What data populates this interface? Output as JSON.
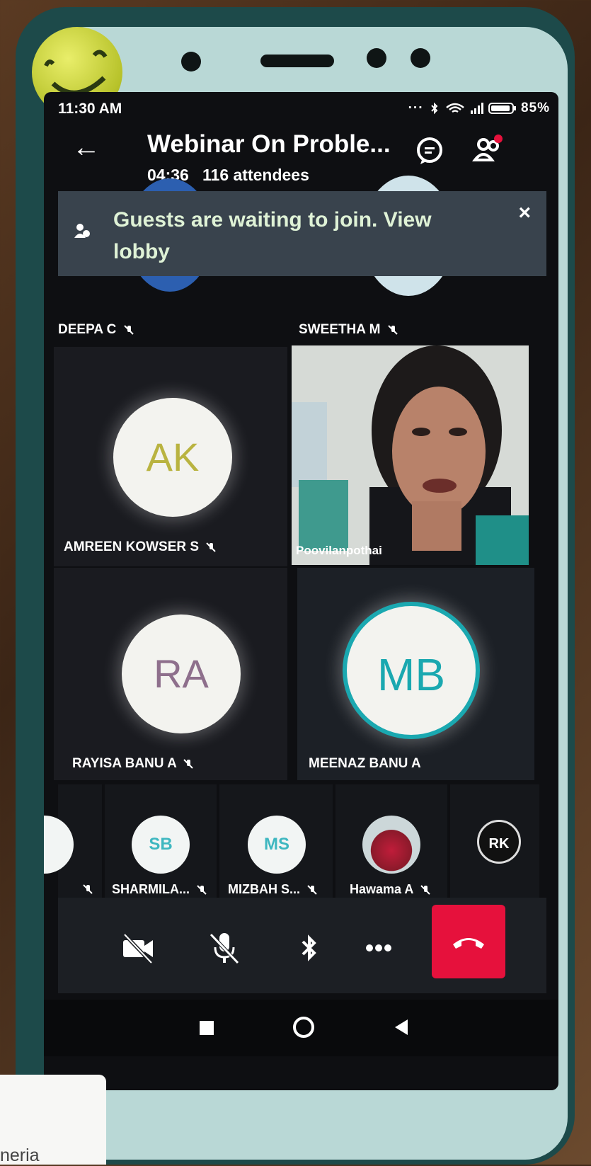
{
  "status_bar": {
    "time": "11:30 AM",
    "indicators": "... ✱ 📶 85%",
    "battery": "85%"
  },
  "meeting": {
    "title": "Webinar On Proble...",
    "timer": "04:36",
    "attendees": "116 attendees"
  },
  "banner": {
    "text": "Guests are waiting to join. View lobby",
    "close_label": "×"
  },
  "participants_grid": [
    {
      "name": "DEEPA C",
      "muted": true
    },
    {
      "name": "SWEETHA M",
      "muted": true
    },
    {
      "name": "AMREEN KOWSER S",
      "initials": "AK",
      "initials_color": "#b9b340",
      "muted": true
    },
    {
      "name": "Poovilanpothai",
      "video": true
    },
    {
      "name": "RAYISA BANU A",
      "initials": "RA",
      "initials_color": "#8e6f8c",
      "muted": true
    },
    {
      "name": "MEENAZ BANU A",
      "initials": "MB",
      "initials_color": "#1aa8b0",
      "muted": false
    }
  ],
  "strip": [
    {
      "name": "SHARMILA...",
      "initials": "SB"
    },
    {
      "name": "MIZBAH S...",
      "initials": "MS"
    },
    {
      "name": "Hawama A",
      "initials": ""
    },
    {
      "name": "",
      "initials": "RK"
    }
  ],
  "controls": [
    "camera-off",
    "mic-off",
    "bluetooth",
    "more",
    "end-call"
  ],
  "card_text": "neria",
  "colors": {
    "end_call": "#e6113c",
    "banner_bg": "#39434d",
    "accent_teal": "#3eb7c0"
  }
}
